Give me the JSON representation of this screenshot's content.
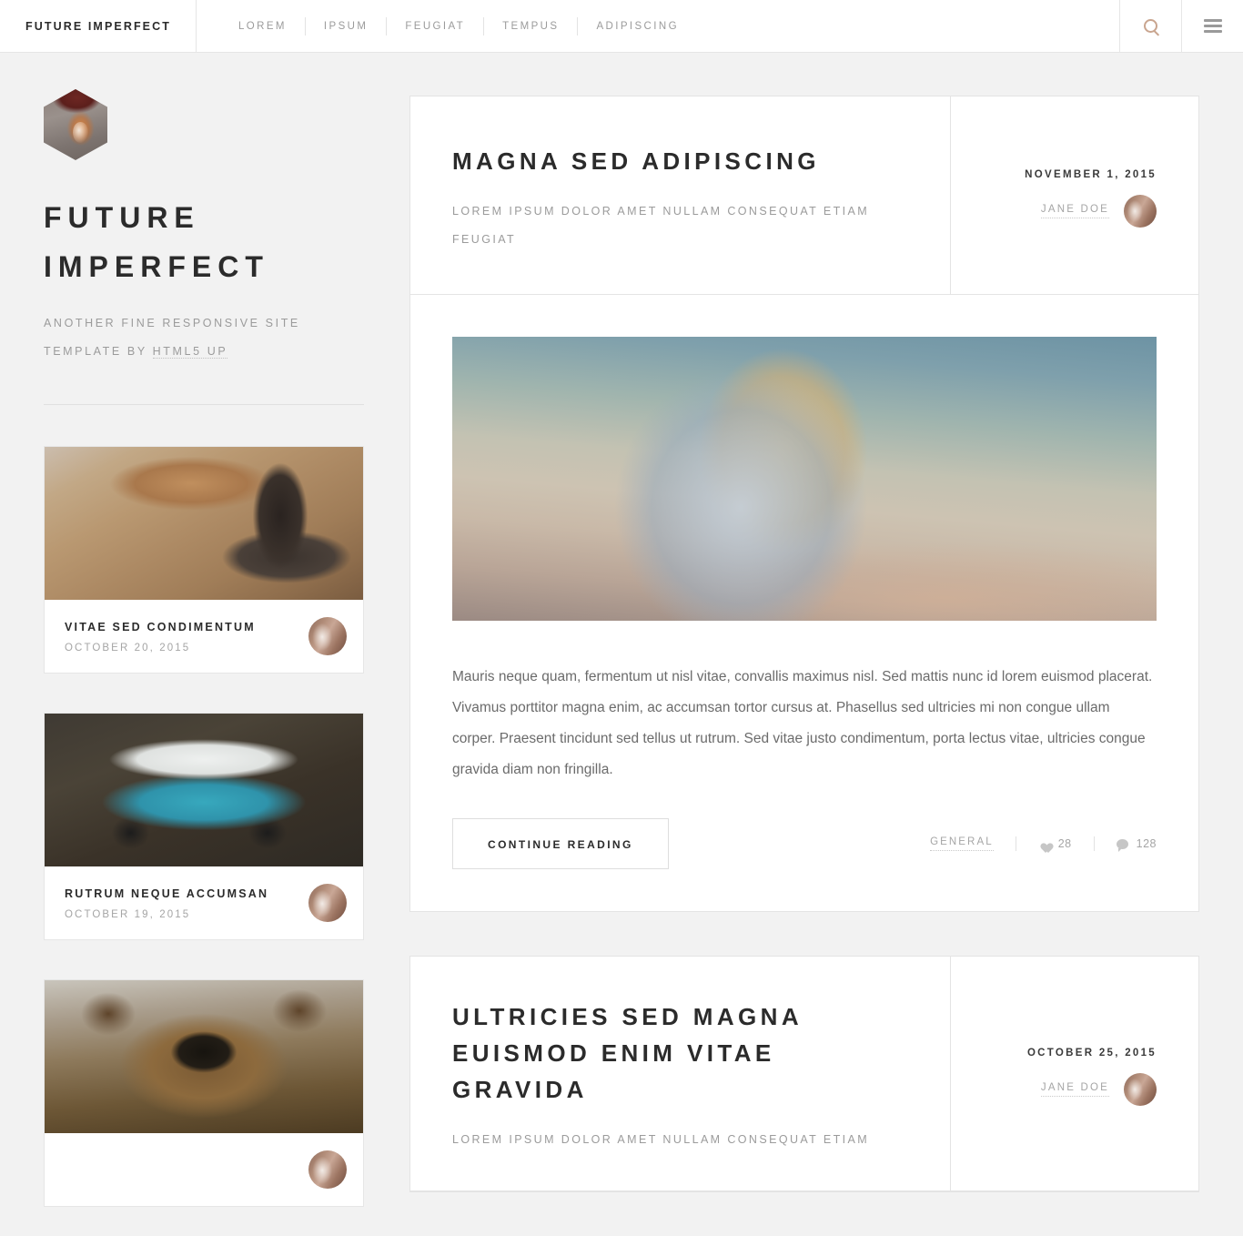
{
  "header": {
    "brand": "FUTURE IMPERFECT",
    "nav": [
      {
        "label": "LOREM"
      },
      {
        "label": "IPSUM"
      },
      {
        "label": "FEUGIAT"
      },
      {
        "label": "TEMPUS"
      },
      {
        "label": "ADIPISCING"
      }
    ],
    "search_icon": "search-icon",
    "menu_icon": "hamburger-menu-icon"
  },
  "sidebar": {
    "avatar_icon": "fox-hexagon-avatar",
    "title": "FUTURE IMPERFECT",
    "tagline_line1": "ANOTHER FINE RESPONSIVE SITE",
    "tagline_line2_prefix": "TEMPLATE BY ",
    "tagline_link": "HTML5 UP",
    "mini_posts": [
      {
        "title": "VITAE SED CONDIMENTUM",
        "date": "OCTOBER 20, 2015",
        "thumb": "workshop-tools-photo",
        "avatar": "jane-doe-avatar"
      },
      {
        "title": "RUTRUM NEQUE ACCUMSAN",
        "date": "OCTOBER 19, 2015",
        "thumb": "teal-van-photo",
        "avatar": "jane-doe-avatar"
      },
      {
        "title": "",
        "date": "",
        "thumb": "brown-bear-photo",
        "avatar": "jane-doe-avatar"
      }
    ]
  },
  "main": {
    "posts": [
      {
        "title": "MAGNA SED ADIPISCING",
        "subtitle": "LOREM IPSUM DOLOR AMET NULLAM CONSEQUAT ETIAM FEUGIAT",
        "date": "NOVEMBER 1, 2015",
        "author": "JANE DOE",
        "author_avatar": "jane-doe-avatar",
        "image": "woman-overlooking-valley-photo",
        "body": "Mauris neque quam, fermentum ut nisl vitae, convallis maximus nisl. Sed mattis nunc id lorem euismod placerat. Vivamus porttitor magna enim, ac accumsan tortor cursus at. Phasellus sed ultricies mi non congue ullam corper. Praesent tincidunt sed tellus ut rutrum. Sed vitae justo condimentum, porta lectus vitae, ultricies congue gravida diam non fringilla.",
        "continue_label": "CONTINUE READING",
        "category": "GENERAL",
        "likes": "28",
        "comments": "128"
      },
      {
        "title": "ULTRICIES SED MAGNA EUISMOD ENIM VITAE GRAVIDA",
        "subtitle": "LOREM IPSUM DOLOR AMET NULLAM CONSEQUAT ETIAM",
        "date": "OCTOBER 25, 2015",
        "author": "JANE DOE",
        "author_avatar": "jane-doe-avatar"
      }
    ]
  },
  "colors": {
    "page_background": "#f2f2f2",
    "card_background": "#ffffff",
    "border": "#e4e4e4",
    "text_dark": "#2b2b2b",
    "text_muted": "#9b9b9b",
    "accent": "#c9a58f"
  }
}
